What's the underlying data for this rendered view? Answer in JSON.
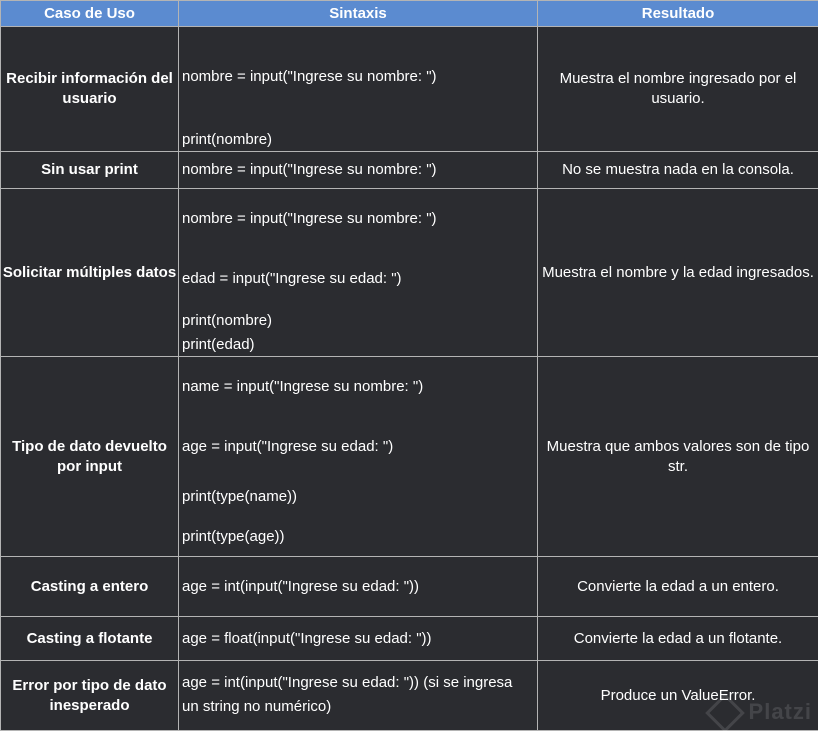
{
  "headers": {
    "case": "Caso de Uso",
    "syntax": "Sintaxis",
    "result": "Resultado"
  },
  "rows": [
    {
      "case": "Recibir información del usuario",
      "lines": [
        "nombre = input(\"Ingrese su nombre: \")",
        "print(nombre)"
      ],
      "result": "Muestra el nombre ingresado por el usuario."
    },
    {
      "case": "Sin usar print",
      "lines": [
        "nombre = input(\"Ingrese su nombre: \")"
      ],
      "result": "No se muestra nada en la consola."
    },
    {
      "case": "Solicitar múltiples datos",
      "lines": [
        "nombre = input(\"Ingrese su nombre: \")",
        "edad = input(\"Ingrese su edad: \")",
        "print(nombre)",
        "print(edad)"
      ],
      "result": "Muestra el nombre y la edad ingresados."
    },
    {
      "case": "Tipo de dato devuelto por input",
      "lines": [
        "name = input(\"Ingrese su nombre: \")",
        "age = input(\"Ingrese su edad: \")",
        "print(type(name))",
        "print(type(age))"
      ],
      "result": "Muestra que ambos valores son de tipo str."
    },
    {
      "case": "Casting a entero",
      "lines": [
        "age = int(input(\"Ingrese su edad: \"))"
      ],
      "result": "Convierte la edad a un entero."
    },
    {
      "case": "Casting a flotante",
      "lines": [
        "age = float(input(\"Ingrese su edad: \"))"
      ],
      "result": "Convierte la edad a un flotante."
    },
    {
      "case": "Error por tipo de dato inesperado",
      "lines": [
        "age = int(input(\"Ingrese su edad: \")) (si se ingresa un string no numérico)"
      ],
      "result": "Produce un ValueError."
    }
  ],
  "watermark": "Platzi",
  "colors": {
    "header_bg": "#5b8bd0",
    "cell_bg": "#2b2c30",
    "border": "#b4b4b4",
    "text": "#ffffff"
  }
}
